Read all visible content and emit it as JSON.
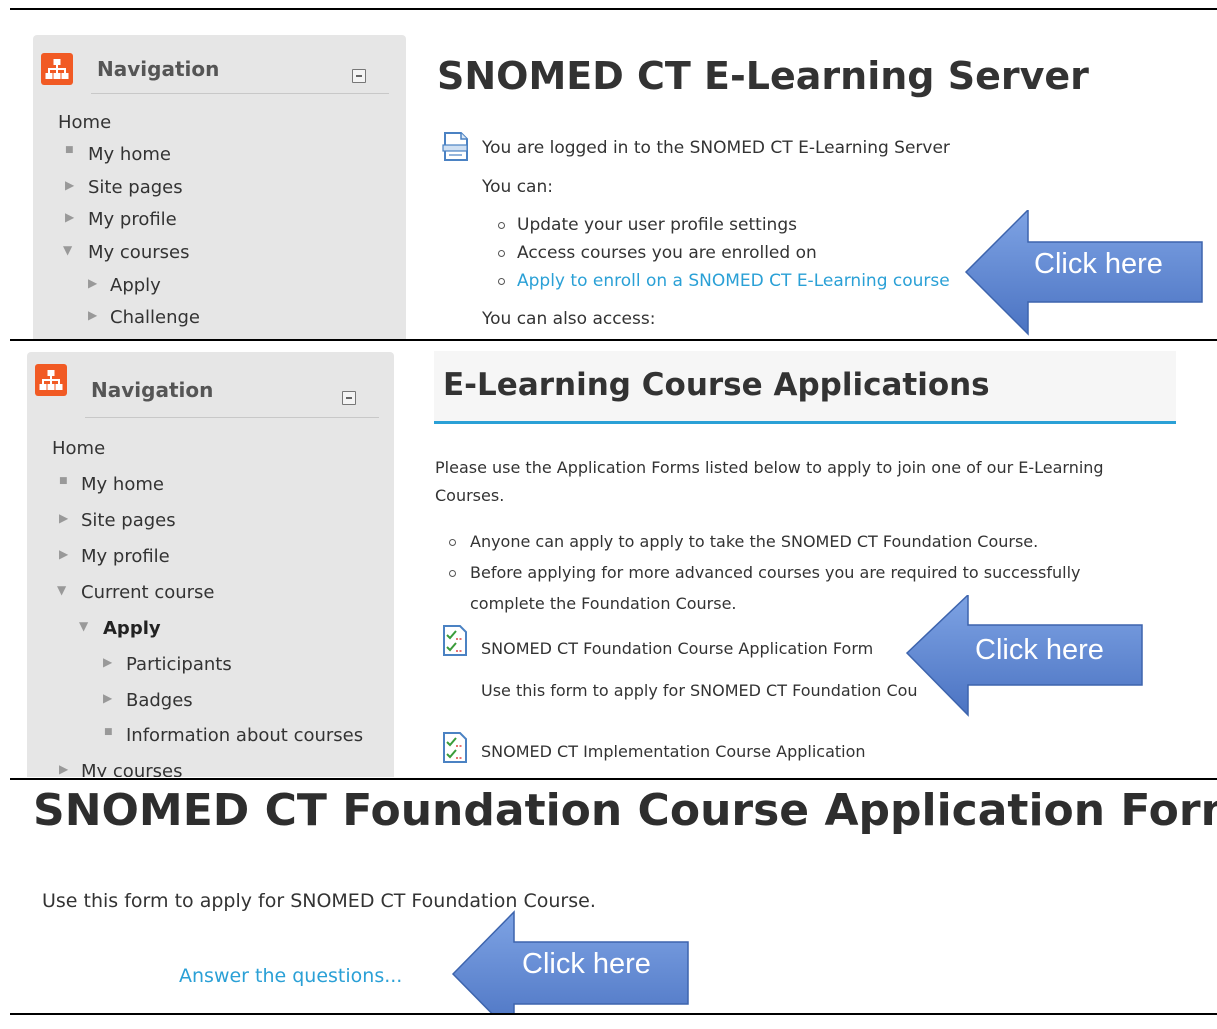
{
  "panel1": {
    "nav": {
      "title": "Navigation",
      "items": [
        {
          "label": "Home",
          "marker": ""
        },
        {
          "label": "My home",
          "marker": "■"
        },
        {
          "label": "Site pages",
          "marker": "▶"
        },
        {
          "label": "My profile",
          "marker": "▶"
        },
        {
          "label": "My courses",
          "marker": "▼"
        },
        {
          "label": "Apply",
          "marker": "▶"
        },
        {
          "label": "Challenge",
          "marker": "▶"
        }
      ]
    },
    "heading": "SNOMED CT E-Learning Server",
    "logged_in": "You are logged in to the SNOMED CT E-Learning Server",
    "you_can": "You can:",
    "bullets": [
      "Update your user profile settings",
      "Access courses you are enrolled on",
      "Apply to enroll on a SNOMED CT E-Learning course"
    ],
    "also_access": "You can also access:",
    "arrow_label": "Click here"
  },
  "panel2": {
    "nav": {
      "title": "Navigation",
      "items": [
        {
          "label": "Home",
          "marker": ""
        },
        {
          "label": "My home",
          "marker": "■"
        },
        {
          "label": "Site pages",
          "marker": "▶"
        },
        {
          "label": "My profile",
          "marker": "▶"
        },
        {
          "label": "Current course",
          "marker": "▼"
        },
        {
          "label": "Apply",
          "marker": "▼"
        },
        {
          "label": "Participants",
          "marker": "▶"
        },
        {
          "label": "Badges",
          "marker": "▶"
        },
        {
          "label": "Information about courses",
          "marker": "■"
        },
        {
          "label": "My courses",
          "marker": "▶"
        }
      ]
    },
    "heading": "E-Learning Course Applications",
    "intro_line1": "Please use the Application Forms listed below to apply to join one of our E-Learning",
    "intro_line2": "Courses.",
    "bullets": [
      "Anyone can apply to apply to take the SNOMED CT Foundation Course.",
      "Before applying for more advanced courses you are required to successfully",
      "complete the Foundation Course."
    ],
    "form1_title": "SNOMED CT Foundation Course Application Form",
    "form1_desc": "Use this form to apply for SNOMED CT Foundation Cou",
    "form2_title": "SNOMED CT Implementation Course Application",
    "arrow_label": "Click here"
  },
  "panel3": {
    "heading": "SNOMED CT Foundation Course Application Form",
    "desc": "Use this form to apply for SNOMED CT Foundation Course.",
    "link": "Answer the questions...",
    "arrow_label": "Click here"
  },
  "colors": {
    "accent_link": "#2aa0d6",
    "nav_icon": "#f15a24",
    "arrow_fill": "#5b86d8",
    "heading_underline": "#2aa0d6"
  }
}
